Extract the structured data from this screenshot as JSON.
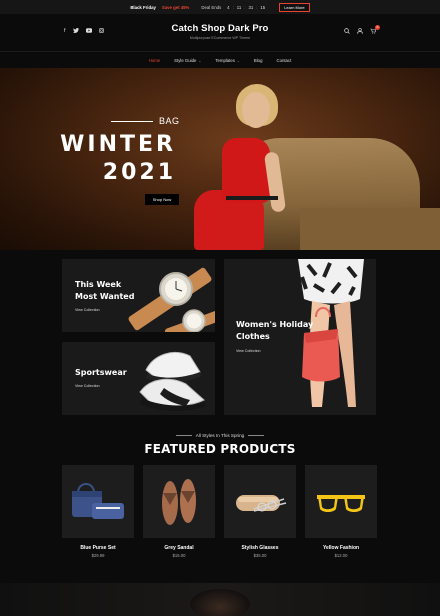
{
  "promo": {
    "label": "Black Friday",
    "save": "Save get 45%",
    "deal_label": "Deal Ends",
    "countdown": [
      "4",
      "11",
      "31",
      "15"
    ],
    "cta": "Learn More"
  },
  "header": {
    "site_title": "Catch Shop Dark Pro",
    "tagline": "Multipurpose ECommerce WP Theme",
    "social_icons": [
      "facebook-icon",
      "twitter-icon",
      "youtube-icon",
      "instagram-icon"
    ],
    "cart_count": "0"
  },
  "nav": {
    "items": [
      {
        "label": "Home",
        "active": true
      },
      {
        "label": "Style Guide",
        "dropdown": true
      },
      {
        "label": "Templates",
        "dropdown": true
      },
      {
        "label": "Blog"
      },
      {
        "label": "Contact"
      }
    ]
  },
  "hero": {
    "kicker": "BAG",
    "line1": "WINTER",
    "line2": "2021",
    "button": "Shop Now"
  },
  "categories": [
    {
      "title_l1": "This Week",
      "title_l2": "Most Wanted",
      "link": "View Collection"
    },
    {
      "title_l1": "Sportswear",
      "title_l2": "",
      "link": "View Collection"
    },
    {
      "title_l1": "Women's Holiday",
      "title_l2": "Clothes",
      "link": "View Collection"
    }
  ],
  "featured": {
    "subtitle": "All Styles In This Spring",
    "title": "FEATURED PRODUCTS",
    "products": [
      {
        "name": "Blue Purse Set",
        "price": "$29.99"
      },
      {
        "name": "Grey Sandal",
        "price": "$15.00"
      },
      {
        "name": "Stylish Glasses",
        "price": "$35.00"
      },
      {
        "name": "Yellow Fashion",
        "price": "$12.00"
      }
    ]
  },
  "colors": {
    "accent": "#e8432e",
    "background": "#0b0b0b",
    "card": "#1a1a1a"
  }
}
